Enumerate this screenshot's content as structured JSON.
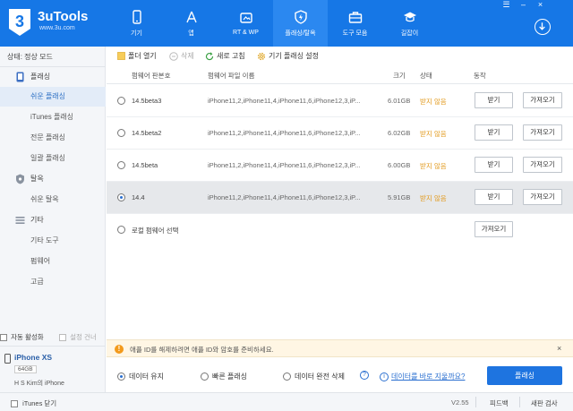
{
  "app": {
    "title": "3uTools",
    "url": "www.3u.com"
  },
  "window": {
    "controls": [
      "☰",
      "–",
      "×"
    ]
  },
  "nav": [
    {
      "label": "기기",
      "icon": "phone-icon"
    },
    {
      "label": "앱",
      "icon": "appstore-icon"
    },
    {
      "label": "RT & WP",
      "icon": "ringtone-wallpaper-icon"
    },
    {
      "label": "플래싱/탈옥",
      "icon": "flash-shield-icon",
      "active": true
    },
    {
      "label": "도구 모음",
      "icon": "toolbox-icon"
    },
    {
      "label": "길잡이",
      "icon": "graduation-cap-icon"
    }
  ],
  "sidebar": {
    "status": "상태: 정상 모드",
    "items": [
      {
        "label": "플래싱",
        "type": "group",
        "icon": "flash-group-icon"
      },
      {
        "label": "쉬운 플래싱",
        "type": "sub",
        "active": true
      },
      {
        "label": "iTunes 플래싱",
        "type": "sub"
      },
      {
        "label": "전문 플래싱",
        "type": "sub"
      },
      {
        "label": "일괄 플래싱",
        "type": "sub"
      },
      {
        "label": "탈옥",
        "type": "group",
        "icon": "jailbreak-group-icon"
      },
      {
        "label": "쉬운 탈옥",
        "type": "sub"
      },
      {
        "label": "기타",
        "type": "group",
        "icon": "other-group-icon"
      },
      {
        "label": "기타 도구",
        "type": "sub"
      },
      {
        "label": "펌웨어",
        "type": "sub"
      },
      {
        "label": "고급",
        "type": "sub"
      }
    ],
    "auto_activate": "자동 활성화",
    "skip_setup": "설정 건너",
    "device": {
      "name": "iPhone XS",
      "capacity": "64GB",
      "owner": "H S Kim의 iPhone"
    }
  },
  "toolbar": {
    "open_folder": "폴더 열기",
    "delete": "삭제",
    "refresh": "새로 고침",
    "settings": "기기 플래싱 설정"
  },
  "table": {
    "headers": {
      "version": "펌웨어 판본호",
      "file": "펌웨어 파일 이름",
      "size": "크기",
      "status": "상태",
      "action": "동작"
    },
    "rows": [
      {
        "version": "14.5beta3",
        "file": "iPhone11,2,iPhone11,4,iPhone11,6,iPhone12,3,iP...",
        "size": "6.01GB",
        "status": "받지 않음",
        "download": "받기",
        "import": "가져오기",
        "selected": false
      },
      {
        "version": "14.5beta2",
        "file": "iPhone11,2,iPhone11,4,iPhone11,6,iPhone12,3,iP...",
        "size": "6.02GB",
        "status": "받지 않음",
        "download": "받기",
        "import": "가져오기",
        "selected": false
      },
      {
        "version": "14.5beta",
        "file": "iPhone11,2,iPhone11,4,iPhone11,6,iPhone12,3,iP...",
        "size": "6.00GB",
        "status": "받지 않음",
        "download": "받기",
        "import": "가져오기",
        "selected": false
      },
      {
        "version": "14.4",
        "file": "iPhone11,2,iPhone11,4,iPhone11,6,iPhone12,3,iP...",
        "size": "5.91GB",
        "status": "받지 않음",
        "download": "받기",
        "import": "가져오기",
        "selected": true
      }
    ],
    "local": {
      "label": "로컬 펌웨어 선택",
      "import": "가져오기"
    }
  },
  "notice": {
    "text": "애플 ID를 해제하려면 애플 ID와 암호를 준비하세요.",
    "close": "×"
  },
  "options": {
    "keep_data": "데이터 유지",
    "quick_flash": "빠른 플래싱",
    "erase_data": "데이터 완전 삭제",
    "help": "?",
    "link": "데이터를 바로 지울까요?",
    "flash_button": "플래싱"
  },
  "statusbar": {
    "itunes_close": "iTunes 닫기",
    "version": "V2.55",
    "feedback": "피드백",
    "update": "새판 검사"
  }
}
